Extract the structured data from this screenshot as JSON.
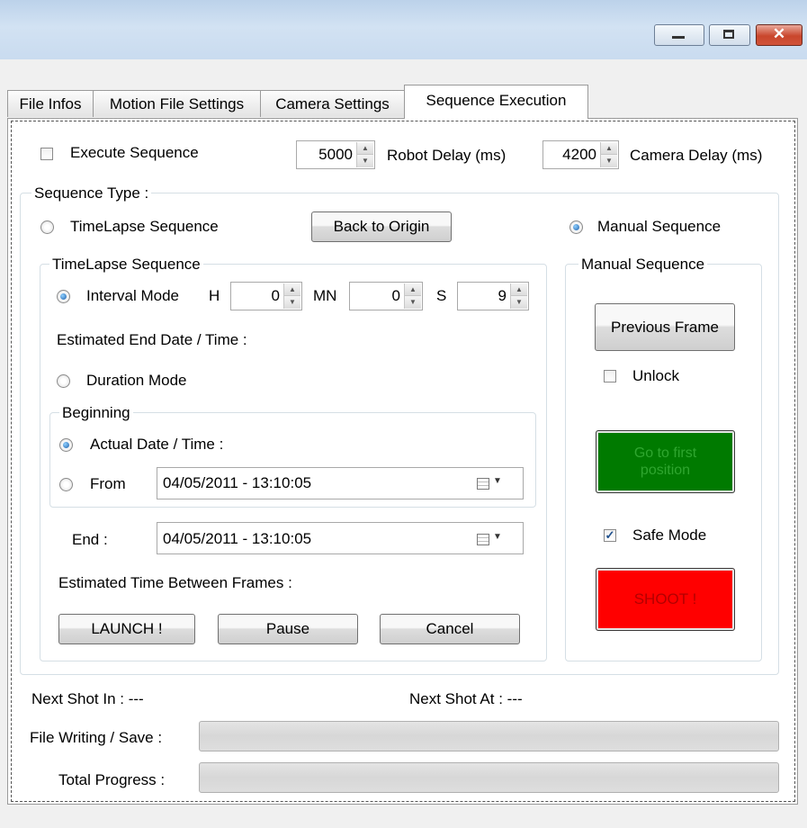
{
  "tabs": [
    {
      "label": "File Infos"
    },
    {
      "label": "Motion File Settings"
    },
    {
      "label": "Camera Settings"
    },
    {
      "label": "Sequence Execution"
    }
  ],
  "top": {
    "execute_label": "Execute Sequence",
    "execute_checked": false,
    "robot_delay_value": "5000",
    "robot_delay_label": "Robot Delay (ms)",
    "camera_delay_value": "4200",
    "camera_delay_label": "Camera Delay (ms)"
  },
  "sequence_type": {
    "legend": "Sequence Type :",
    "timelapse_radio": "TimeLapse Sequence",
    "back_to_origin": "Back to Origin",
    "manual_radio": "Manual Sequence",
    "selected": "manual"
  },
  "timelapse": {
    "legend": "TimeLapse Sequence",
    "interval_mode": "Interval Mode",
    "h_label": "H",
    "h_value": "0",
    "mn_label": "MN",
    "mn_value": "0",
    "s_label": "S",
    "s_value": "9",
    "estimated_end": "Estimated End Date / Time :",
    "duration_mode": "Duration Mode",
    "beginning_legend": "Beginning",
    "actual_date": "Actual Date / Time :",
    "from_label": "From",
    "from_value": "04/05/2011 - 13:10:05",
    "end_label": "End :",
    "end_value": "04/05/2011 - 13:10:05",
    "estimated_between": "Estimated Time Between Frames :",
    "launch": "LAUNCH !",
    "pause": "Pause",
    "cancel": "Cancel"
  },
  "manual": {
    "legend": "Manual Sequence",
    "previous_frame": "Previous Frame",
    "unlock": "Unlock",
    "unlock_checked": false,
    "go_first_line1": "Go to first",
    "go_first_line2": "position",
    "safe_mode": "Safe Mode",
    "safe_mode_checked": true,
    "shoot": "SHOOT !"
  },
  "status": {
    "next_shot_in": "Next Shot In  : ---",
    "next_shot_at": "Next Shot At  : ---",
    "file_writing_label": "File Writing / Save :",
    "file_writing_progress": 0,
    "total_progress_label": "Total Progress  :",
    "total_progress": 0
  },
  "colors": {
    "go_first_bg": "#007a00",
    "go_first_text": "#2fa62f",
    "shoot_bg": "#ff0000",
    "shoot_text": "#b30000",
    "accent": "#1f5fa8"
  },
  "icons": {
    "window_minimize": "minimize-icon",
    "window_restore": "restore-icon",
    "window_close": "close-icon",
    "calendar": "calendar-dropdown-icon"
  }
}
